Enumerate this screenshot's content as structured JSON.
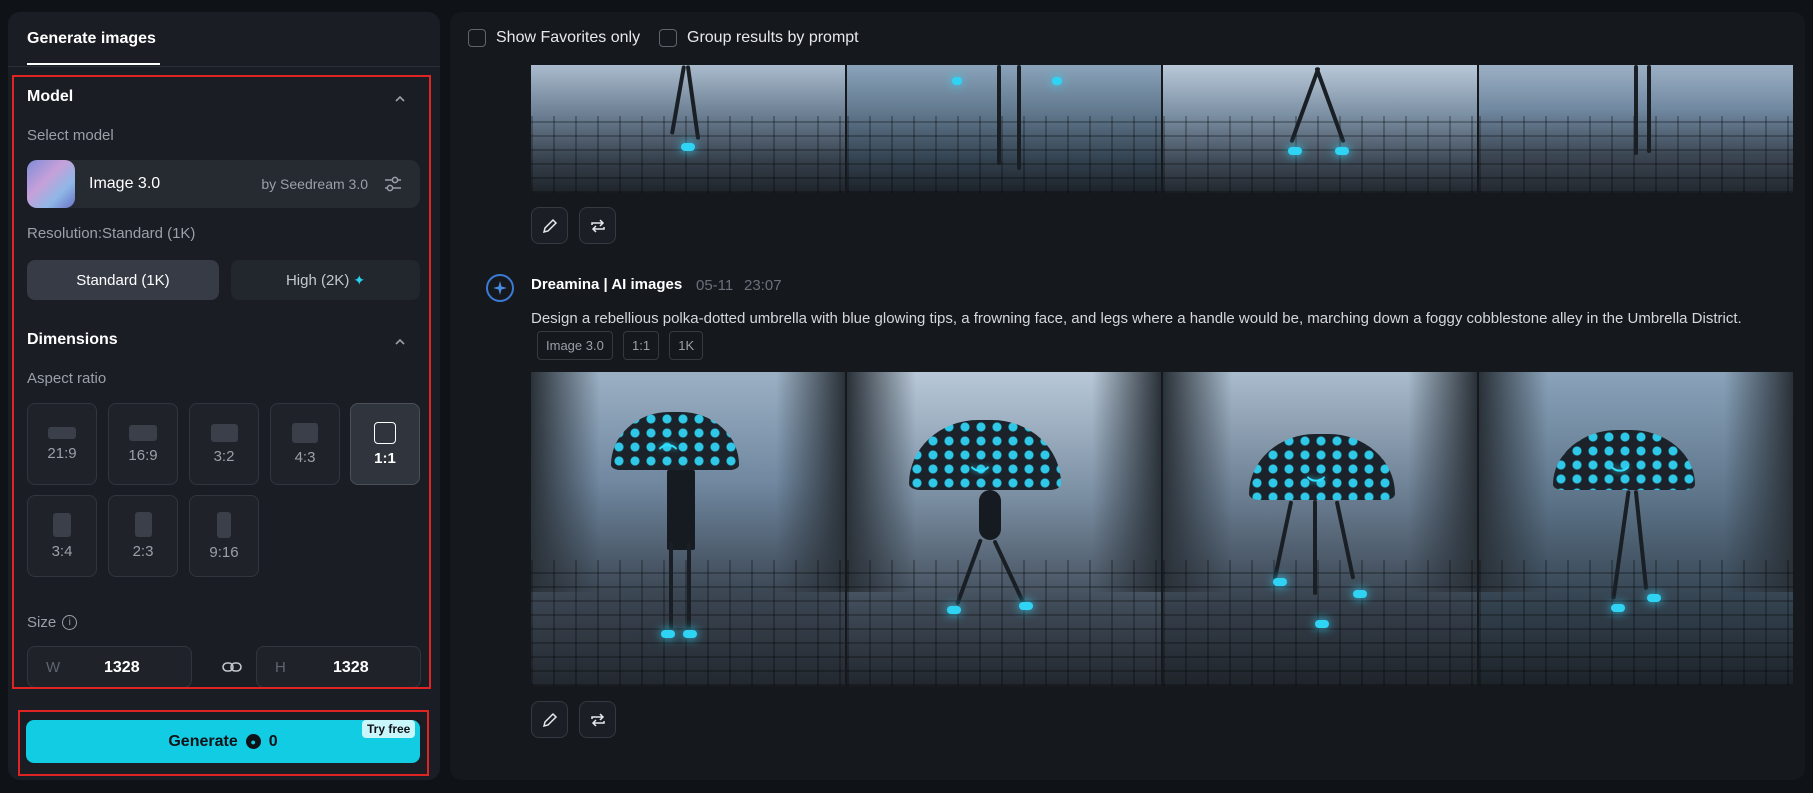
{
  "panel": {
    "tab_label": "Generate images",
    "model_section": {
      "title": "Model",
      "select_label": "Select model",
      "model_name": "Image 3.0",
      "model_by": "by Seedream 3.0",
      "resolution_label": "Resolution:Standard (1K)",
      "resolution_options": [
        "Standard (1K)",
        "High (2K)"
      ],
      "resolution_selected": "Standard (1K)"
    },
    "dimensions_section": {
      "title": "Dimensions",
      "aspect_label": "Aspect ratio",
      "aspect_ratios": [
        "21:9",
        "16:9",
        "3:2",
        "4:3",
        "1:1",
        "3:4",
        "2:3",
        "9:16"
      ],
      "aspect_selected": "1:1",
      "size_label": "Size",
      "width_prefix": "W",
      "width_value": "1328",
      "height_prefix": "H",
      "height_value": "1328"
    },
    "generate": {
      "label": "Generate",
      "credits": "0",
      "badge": "Try free"
    }
  },
  "filters": {
    "favorites_label": "Show Favorites only",
    "group_label": "Group results by prompt"
  },
  "result": {
    "author": "Dreamina | AI images",
    "date": "05-11",
    "time": "23:07",
    "prompt": "Design a rebellious polka-dotted umbrella with blue glowing tips, a frowning face, and legs where a handle would be, marching down a foggy cobblestone alley in the Umbrella District.",
    "tags": [
      "Image 3.0",
      "1:1",
      "1K"
    ]
  },
  "colors": {
    "accent": "#12cce3",
    "highlight_border": "#e02424",
    "panel_bg": "#1a1d23",
    "page_bg": "#0f1217"
  }
}
